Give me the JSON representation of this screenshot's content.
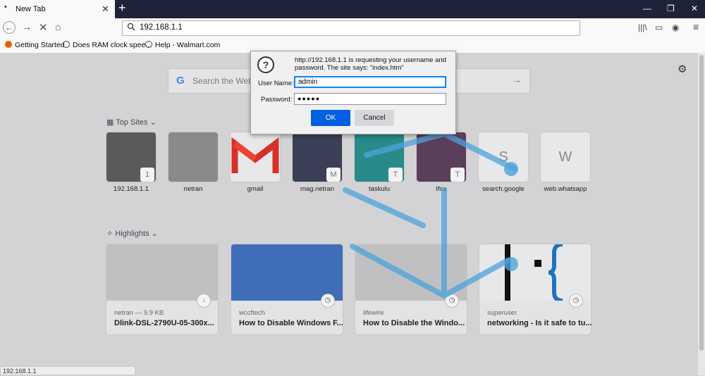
{
  "tab": {
    "title": "New Tab"
  },
  "toolbar": {
    "url": "192.168.1.1"
  },
  "bookmarks": [
    "Getting Started",
    "Does RAM clock spee...",
    "Help - Walmart.com"
  ],
  "search": {
    "placeholder": "Search the Web"
  },
  "top_sites": {
    "heading": "Top Sites",
    "items": [
      {
        "label": "192.168.1.1",
        "badge": "1"
      },
      {
        "label": "netran",
        "badge": ""
      },
      {
        "label": "gmail",
        "badge": ""
      },
      {
        "label": "mag.netran",
        "badge": "M"
      },
      {
        "label": "taskulu",
        "badge": "T"
      },
      {
        "label": "tfca",
        "badge": "T"
      },
      {
        "label": "search.google",
        "letter": "S"
      },
      {
        "label": "web.whatsapp",
        "letter": "W"
      }
    ]
  },
  "highlights": {
    "heading": "Highlights",
    "items": [
      {
        "source": "netran — 9.9 KB",
        "title": "Dlink-DSL-2790U-05-300x..."
      },
      {
        "source": "wccftech",
        "title": "How to Disable Windows F..."
      },
      {
        "source": "lifewire",
        "title": "How to Disable the Windo..."
      },
      {
        "source": "superuser",
        "title": "networking - Is it safe to tu..."
      }
    ]
  },
  "dialog": {
    "message": "http://192.168.1.1 is requesting your username and password. The site says: “index.htm”",
    "username_label": "User Name:",
    "username_value": "admin",
    "password_label": "Password:",
    "password_value": "●●●●●",
    "ok": "OK",
    "cancel": "Cancel"
  },
  "status": {
    "text": "192.168.1.1"
  }
}
